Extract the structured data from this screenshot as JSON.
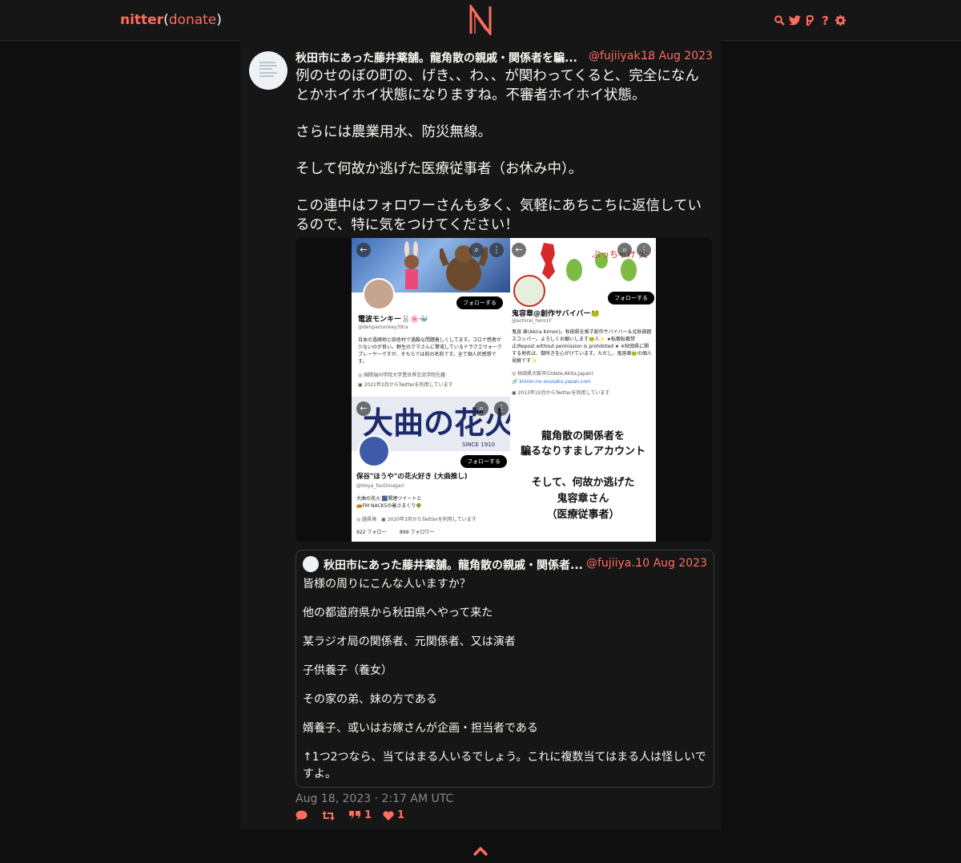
{
  "nav": {
    "brand": "nitter",
    "paren_open": "(",
    "donate": "donate",
    "paren_close": ")",
    "icons": [
      "search-icon",
      "twitter-icon",
      "rss-icon",
      "help-icon",
      "settings-icon"
    ],
    "help_glyph": "?"
  },
  "tweet": {
    "fullname": "秋田市にあった藤井薬舗。龍角散の親戚・関係者を騙...",
    "username": "@fujiiyak...",
    "date": "18 Aug 2023",
    "body": [
      "例のせのぼの町の、げき、、わ、、が関わってくると、完全になんとかホイホイ状態になりますね。不審者ホイホイ状態。",
      "さらには農業用水、防災無線。",
      "そして何故か逃げた医療従事者（お休み中）。",
      "この連中はフォロワーさんも多く、気軽にあちこちに返信しているので、特に気をつけてください！"
    ],
    "published": "Aug 18, 2023 · 2:17 AM UTC",
    "stats": {
      "replies": "",
      "retweets": "",
      "quotes": "1",
      "likes": "1"
    }
  },
  "media": {
    "p1": {
      "name": "電波モンキー🐰🌸🐳",
      "handle": "@denpamonkey39ra",
      "follow": "フォローする",
      "bio": "日本の過疎地と田舎村で過酷な問題着しくしてます。コロナ感者が少ないのが良い。野生のクマさんに警戒しているドラクエウォークプレーヤーですが、そちらでは前の名前です。全て個人的感想です。",
      "meta1": "◎ 国際瑞州学院大学異世界交流学院在籍",
      "meta2": "▣ 2021年2月からTwitterを利用しています"
    },
    "p2": {
      "name": "鬼容章@創作サバイバー🐸",
      "handle": "@achiral_hero1F",
      "follow": "フォローする",
      "bio": "鬼容 章(Akira Kimon)。秋田県を推す創作サバイバー＆北秋田郡スコッパー。よろしくお願いします🐸人✨ ★転載転載禁止/Repost without permission is prohibited ★ ※秋田県に関する地名は、御所きを心がけています。ただし、鬼容章🐸の個人見解です✨",
      "meta1": "◎ 秋田県大館市(Odate,Akita,Japan)",
      "meta2": "🔗 kimon-no-sousaku.yasan.com",
      "meta3": "▣ 2013年10月からTwitterを利用しています",
      "banner_text": "ぶっちゃけ 大いなる 秋田"
    },
    "p3": {
      "banner": "大曲の花火",
      "since": "SINCE 1910",
      "name": "保谷\"ほうや\"の花火好き (大曲推し)",
      "handle": "@Hoya_favOmagari",
      "follow": "フォローする",
      "bio1": "大曲の花火 🎆関連ツイートと",
      "bio2": "📻FM NACK5の暑さまくり🌳",
      "meta": "◎ 越県境　▣ 2020年3月からTwitterを利用しています",
      "following": "922 フォロー",
      "followers": "899 フォロワー"
    },
    "p4": {
      "lines1": [
        "龍角散の関係者を",
        "騙るなりすましアカウント"
      ],
      "lines2": [
        "そして、何故か逃げた",
        "鬼容章さん",
        "（医療従事者）"
      ]
    }
  },
  "quote": {
    "fullname": "秋田市にあった藤井薬舗。龍角散の親戚・関係者...",
    "username": "@fujiiya...",
    "date": "10 Aug 2023",
    "body": [
      "皆様の周りにこんな人いますか？",
      "他の都道府県から秋田県へやって来た",
      "某ラジオ局の関係者、元関係者、又は演者",
      "子供養子（養女）",
      "その家の弟、妹の方である",
      "婿養子、或いはお嫁さんが企画・担当者である",
      "↑1つ2つなら、当てはまる人いるでしょう。これに複数当てはまる人は怪しいですよ。"
    ]
  },
  "colors": {
    "accent": "#ff6c60",
    "background": "#0f0f0f",
    "panel": "#161616",
    "text": "#f8f8f2",
    "muted": "#888889"
  }
}
